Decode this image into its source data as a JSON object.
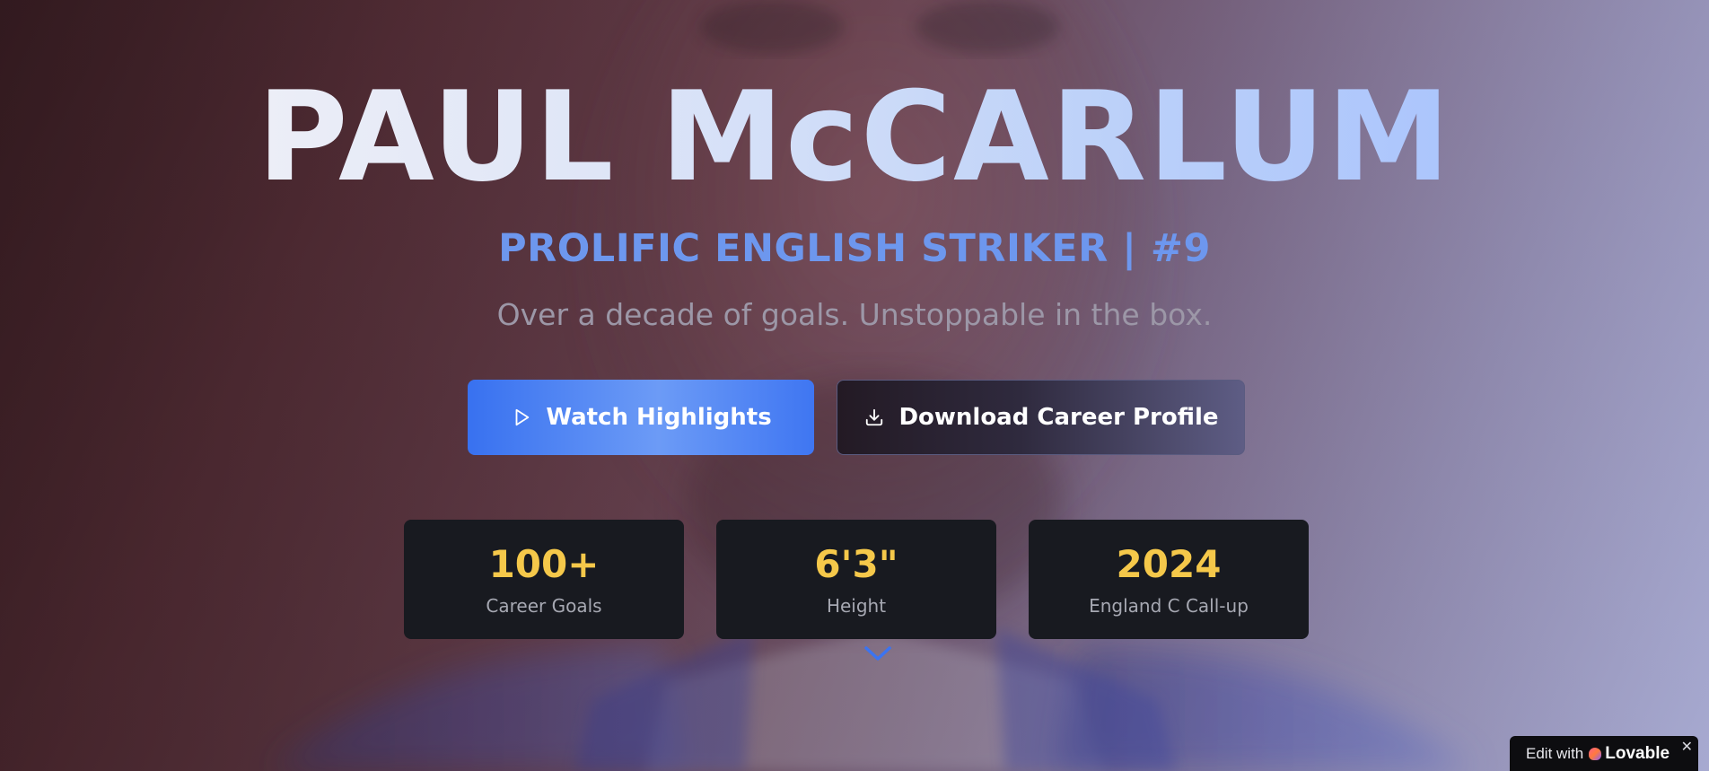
{
  "hero": {
    "title": "PAUL McCARLUM",
    "subtitle": "PROLIFIC ENGLISH STRIKER | #9",
    "tagline": "Over a decade of goals. Unstoppable in the box."
  },
  "buttons": {
    "primary_label": "Watch Highlights",
    "primary_icon": "play-icon",
    "secondary_label": "Download Career Profile",
    "secondary_icon": "download-icon"
  },
  "stats": [
    {
      "value": "100+",
      "label": "Career Goals"
    },
    {
      "value": "6'3\"",
      "label": "Height"
    },
    {
      "value": "2024",
      "label": "England C Call-up"
    }
  ],
  "scroll": {
    "icon": "chevron-down-icon"
  },
  "badge": {
    "prefix": "Edit with",
    "brand": "Lovable",
    "close": "✕"
  },
  "colors": {
    "accent": "#3b74f1",
    "stat_value": "#f5c84a",
    "subtitle": "#6d97ee",
    "card_bg": "#181a20"
  }
}
